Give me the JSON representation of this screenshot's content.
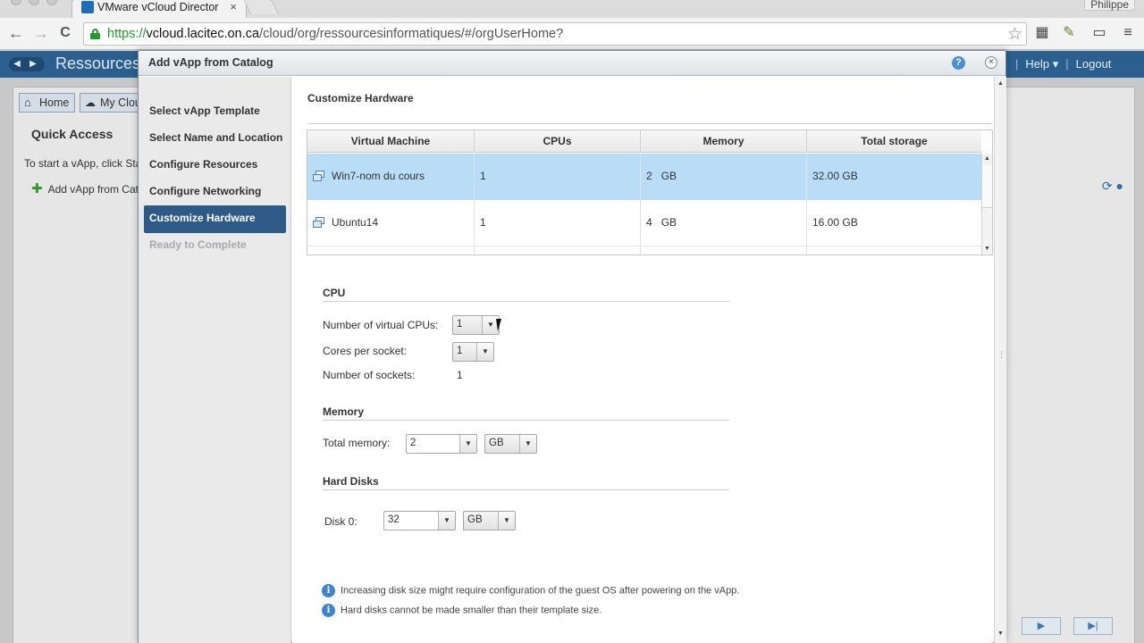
{
  "browser": {
    "tab_title": "VMware vCloud Director",
    "tab_close": "×",
    "profile": "Philippe",
    "url_scheme": "https://",
    "url_host": "vcloud.lacitec.on.ca",
    "url_path": "/cloud/org/ressourcesinformatiques/#/orgUserHome?",
    "back_glyph": "←",
    "forward_glyph": "→",
    "reload_glyph": "C",
    "star_glyph": "☆"
  },
  "app": {
    "title": "Ressources",
    "help_label": "Help ▾",
    "separator": "|",
    "logout_label": "Logout",
    "tabs": [
      {
        "label": "Home"
      },
      {
        "label": "My Clou"
      }
    ],
    "quick_access_title": "Quick Access",
    "quick_access_text": "To start a vApp, click Sta",
    "add_vapp_label": "Add vApp from Cat"
  },
  "dialog": {
    "title": "Add vApp from Catalog",
    "help_glyph": "?",
    "close_glyph": "×",
    "steps": [
      {
        "label": "Select vApp Template",
        "state": "normal"
      },
      {
        "label": "Select Name and Location",
        "state": "normal"
      },
      {
        "label": "Configure Resources",
        "state": "normal"
      },
      {
        "label": "Configure Networking",
        "state": "normal"
      },
      {
        "label": "Customize Hardware",
        "state": "active"
      },
      {
        "label": "Ready to Complete",
        "state": "disabled"
      }
    ],
    "section_title": "Customize Hardware",
    "table": {
      "columns": [
        "Virtual Machine",
        "CPUs",
        "Memory",
        "Total storage"
      ],
      "rows": [
        {
          "vm": "Win7-nom du cours",
          "cpus": "1",
          "memory_value": "2",
          "memory_unit": "GB",
          "storage": "32.00 GB",
          "selected": true
        },
        {
          "vm": "Ubuntu14",
          "cpus": "1",
          "memory_value": "4",
          "memory_unit": "GB",
          "storage": "16.00 GB",
          "selected": false
        }
      ]
    },
    "cpu": {
      "title": "CPU",
      "vcpus_label": "Number of virtual CPUs:",
      "vcpus_value": "1",
      "cores_label": "Cores per socket:",
      "cores_value": "1",
      "sockets_label": "Number of sockets:",
      "sockets_value": "1"
    },
    "memory": {
      "title": "Memory",
      "total_label": "Total memory:",
      "total_value": "2",
      "unit_value": "GB"
    },
    "hard_disks": {
      "title": "Hard Disks",
      "disk0_label": "Disk 0:",
      "disk0_value": "32",
      "disk0_unit": "GB"
    },
    "notes": [
      "Increasing disk size might require configuration of the guest OS after powering on the vApp.",
      "Hard disks cannot be made smaller than their template size."
    ]
  },
  "colors": {
    "accent": "#2d5a87",
    "selected_row": "#b9dcf7",
    "app_header": "#2a5f8f"
  }
}
